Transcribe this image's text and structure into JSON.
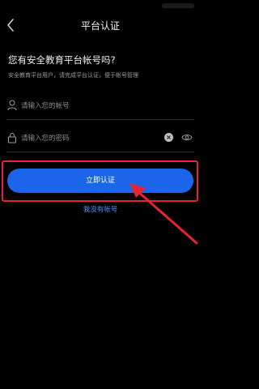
{
  "nav": {
    "title": "平台认证"
  },
  "intro": {
    "heading": "您有安全教育平台帐号吗?",
    "subtext": "安全教育平台用户，请完成平台认证，便于帐号管理"
  },
  "form": {
    "account_placeholder": "请输入您的帐号",
    "password_placeholder": "请输入您的密码"
  },
  "actions": {
    "submit_label": "立即认证",
    "no_account_label": "我没有帐号"
  },
  "colors": {
    "background": "#000000",
    "primary_button": "#1b66e8",
    "link": "#4a8cff",
    "annotation_red": "#e8252f"
  }
}
